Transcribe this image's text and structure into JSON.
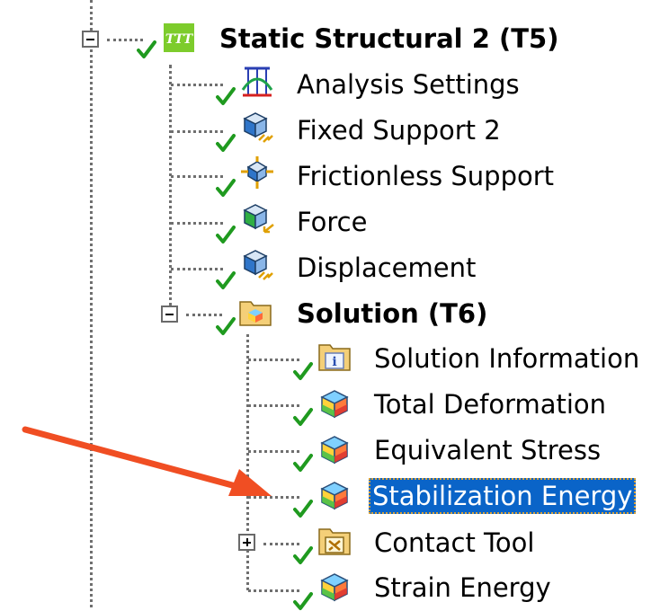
{
  "tree": {
    "static_structural": {
      "label": "Static Structural 2 (T5)"
    },
    "analysis_settings": {
      "label": "Analysis Settings"
    },
    "fixed_support": {
      "label": "Fixed Support 2"
    },
    "frictionless_support": {
      "label": "Frictionless Support"
    },
    "force": {
      "label": "Force"
    },
    "displacement": {
      "label": "Displacement"
    },
    "solution": {
      "label": "Solution (T6)"
    },
    "solution_information": {
      "label": "Solution Information"
    },
    "total_deformation": {
      "label": "Total Deformation"
    },
    "equivalent_stress": {
      "label": "Equivalent Stress"
    },
    "stabilization_energy": {
      "label": "Stabilization Energy",
      "selected": true
    },
    "contact_tool": {
      "label": "Contact Tool"
    },
    "strain_energy": {
      "label": "Strain Energy"
    }
  },
  "colors": {
    "selection": "#0a64c8",
    "check": "#1f9a1f",
    "arrow": "#f04e23"
  },
  "icons": {
    "static_structural": "static-structural-icon",
    "analysis_settings": "analysis-settings-icon",
    "support": "support-cube-icon",
    "frictionless": "frictionless-support-icon",
    "solution_folder": "solution-folder-icon",
    "info_folder": "solution-info-icon",
    "result": "result-cube-icon",
    "contact_tool": "contact-tool-icon",
    "check": "green-check-icon"
  }
}
